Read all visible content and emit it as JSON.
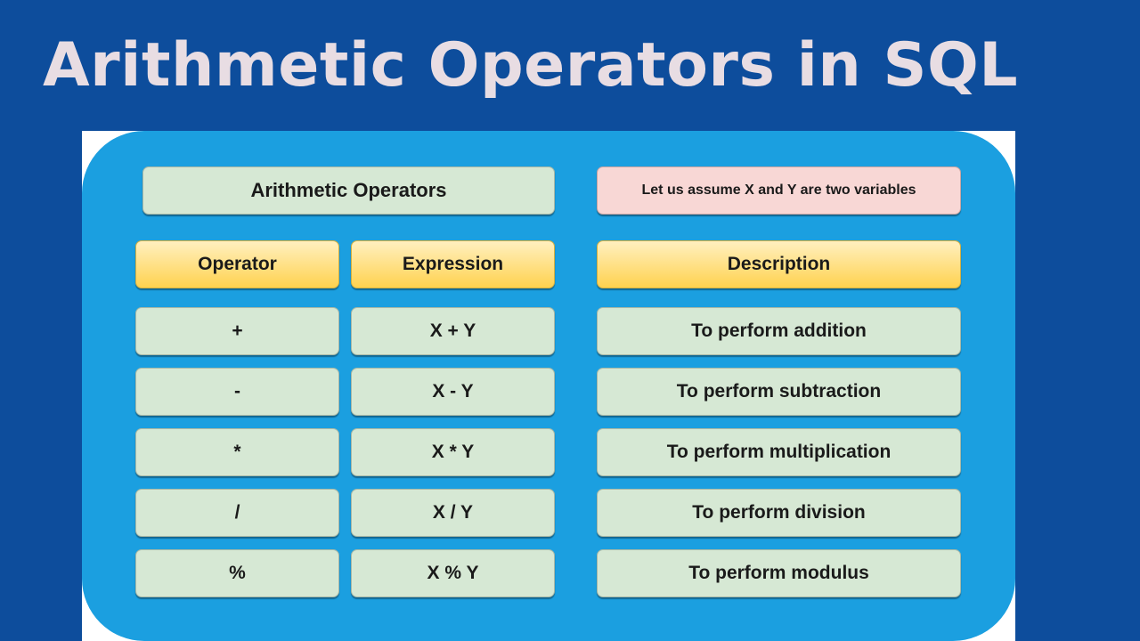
{
  "title": "Arithmetic Operators in SQL",
  "diagram": {
    "heading": "Arithmetic Operators",
    "note": "Let us assume  X and Y are two variables",
    "columns": {
      "operator": "Operator",
      "expression": "Expression",
      "description": "Description"
    },
    "rows": [
      {
        "operator": "+",
        "expression": "X + Y",
        "description": "To perform addition"
      },
      {
        "operator": "-",
        "expression": "X - Y",
        "description": "To perform subtraction"
      },
      {
        "operator": "*",
        "expression": "X * Y",
        "description": "To perform multiplication"
      },
      {
        "operator": "/",
        "expression": "X / Y",
        "description": "To perform division"
      },
      {
        "operator": "%",
        "expression": "X % Y",
        "description": "To perform modulus"
      }
    ],
    "colors": {
      "background": "#0d4d9c",
      "panel": "#1b9fe0",
      "cell": "#d6e8d4",
      "header": "#ffd24f",
      "note": "#f8d7d5",
      "title_text": "#e8dde3"
    }
  }
}
